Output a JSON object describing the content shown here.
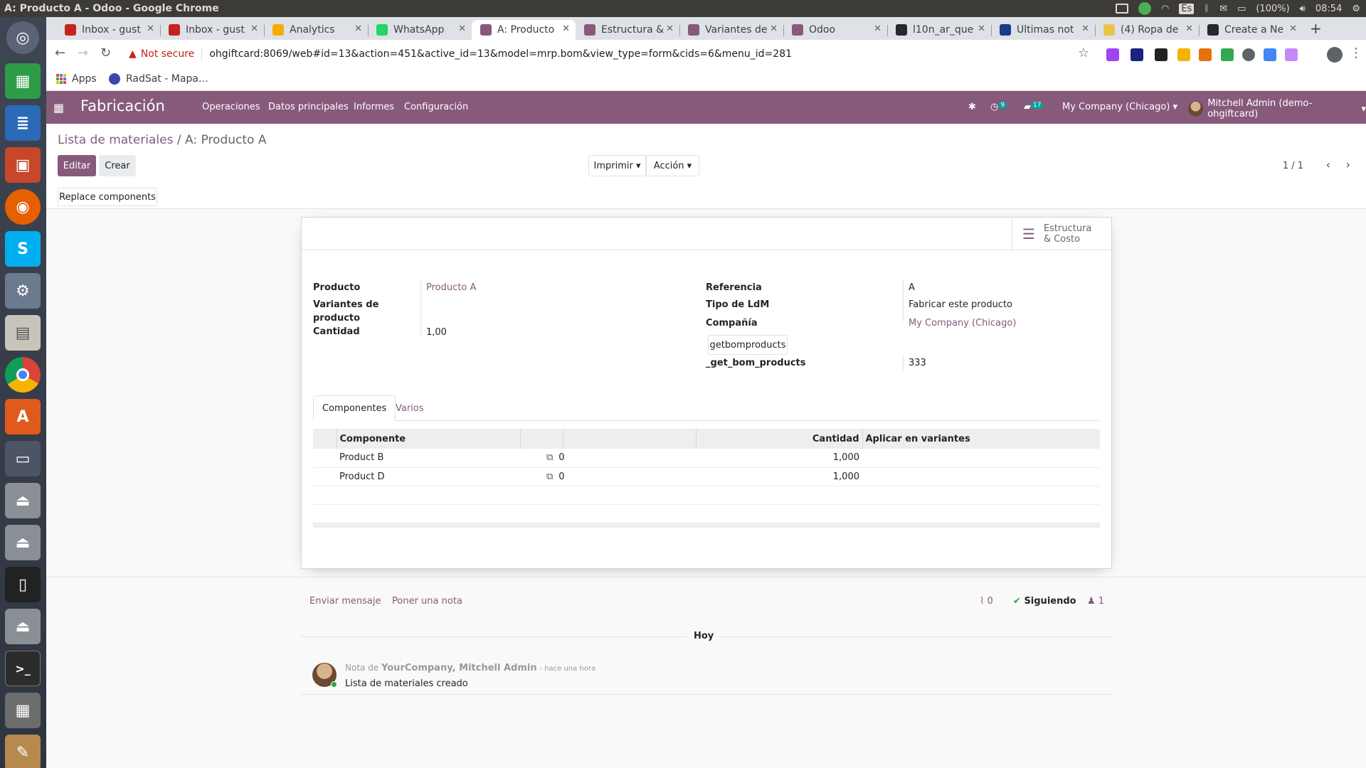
{
  "os": {
    "window_title": "A: Producto A - Odoo - Google Chrome",
    "tray": {
      "keyboard": "Es",
      "battery": "(100%)",
      "clock": "08:54"
    }
  },
  "launcher": {
    "items": [
      "ubuntu-icon",
      "spreadsheet-icon",
      "writer-icon",
      "impress-icon",
      "firefox-icon",
      "skype-icon",
      "settings-icon",
      "files-icon",
      "chrome-icon",
      "software-center-icon",
      "window-icon",
      "drive-icon",
      "drive-icon",
      "phone-icon",
      "drive-icon",
      "terminal-icon",
      "calculator-icon",
      "editor-icon"
    ]
  },
  "browser": {
    "tabs": [
      {
        "label": "Inbox - gust",
        "color": "#c5221f"
      },
      {
        "label": "Inbox - gust",
        "color": "#c5221f"
      },
      {
        "label": "Analytics",
        "color": "#f9ab00"
      },
      {
        "label": "WhatsApp",
        "color": "#25d366"
      },
      {
        "label": "A: Producto",
        "color": "#875a7b"
      },
      {
        "label": "Estructura &",
        "color": "#875a7b"
      },
      {
        "label": "Variantes de",
        "color": "#875a7b"
      },
      {
        "label": "Odoo",
        "color": "#875a7b"
      },
      {
        "label": "l10n_ar_que",
        "color": "#24292e"
      },
      {
        "label": "Últimas not",
        "color": "#1a3a8a"
      },
      {
        "label": "(4) Ropa de",
        "color": "#e8c547"
      },
      {
        "label": "Create a Ne",
        "color": "#24292e"
      }
    ],
    "new_tab": "+",
    "not_secure": "Not secure",
    "url": "ohgiftcard:8069/web#id=13&action=451&active_id=13&model=mrp.bom&view_type=form&cids=6&menu_id=281",
    "bookmarks": [
      {
        "label": "Apps",
        "icon": "apps-grid-icon"
      },
      {
        "label": "RadSat - Mapa…",
        "icon": "radsat-icon"
      }
    ]
  },
  "odoo": {
    "app_name": "Fabricación",
    "menu": [
      "Operaciones",
      "Datos principales",
      "Informes",
      "Configuración"
    ],
    "activity_count": "9",
    "message_count": "17",
    "company": "My Company (Chicago)",
    "user": "Mitchell Admin (demo-ohgiftcard)",
    "breadcrumb": {
      "parent": "Lista de materiales",
      "sep": " / ",
      "current": "A: Producto A"
    },
    "buttons": {
      "edit": "Editar",
      "create": "Crear",
      "print": "Imprimir",
      "action": "Acción",
      "replace": "Replace components"
    },
    "pager": "1 / 1",
    "smart_button": "Estructura & Costo",
    "form": {
      "producto_label": "Producto",
      "producto_value": "Producto A",
      "variantes_label_1": "Variantes de",
      "variantes_label_2": "producto",
      "cantidad_label": "Cantidad",
      "cantidad_value": "1,00",
      "referencia_label": "Referencia",
      "referencia_value": "A",
      "tipo_label": "Tipo de LdM",
      "tipo_value": "Fabricar este producto",
      "compania_label": "Compañía",
      "compania_value": "My Company (Chicago)",
      "getbom_button": "getbomproducts",
      "getbom_label": "_get_bom_products",
      "getbom_value": "333"
    },
    "notebook": {
      "tab_components": "Componentes",
      "tab_misc": "Varios"
    },
    "components_table": {
      "headers": [
        "Componente",
        "",
        "",
        "Cantidad",
        "Aplicar en variantes"
      ],
      "rows": [
        {
          "component": "Product B",
          "count": "0",
          "qty": "1,000",
          "variants": ""
        },
        {
          "component": "Product D",
          "count": "0",
          "qty": "1,000",
          "variants": ""
        }
      ]
    },
    "chatter": {
      "send_message": "Enviar mensaje",
      "log_note": "Poner una nota",
      "attachments": "0",
      "following": "Siguiendo",
      "followers": "1",
      "date_separator": "Hoy",
      "message": {
        "prefix": "Nota de",
        "author": "YourCompany, Mitchell Admin",
        "time": "- hace una hora",
        "body": "Lista de materiales creado"
      }
    }
  }
}
